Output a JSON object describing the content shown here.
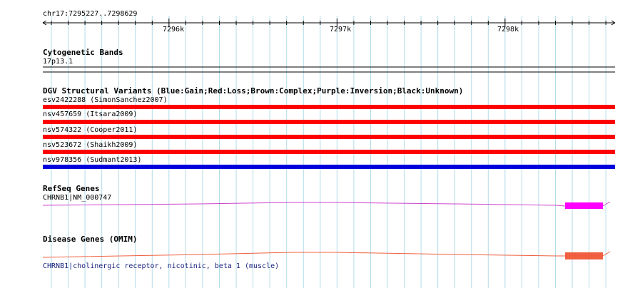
{
  "ruler": {
    "range_label": "chr17:7295227..7298629",
    "ticks": [
      "7296k",
      "7297k",
      "7298k"
    ]
  },
  "tracks": {
    "cytoband": {
      "title": "Cytogenetic Bands",
      "band": "17p13.1"
    },
    "dgv": {
      "title": "DGV Structural Variants (Blue:Gain;Red:Loss;Brown:Complex;Purple:Inversion;Black:Unknown)",
      "variants": [
        {
          "label": "esv2422288 (SimonSanchez2007)",
          "type": "Loss",
          "color": "#ff0000"
        },
        {
          "label": "nsv457659 (Itsara2009)",
          "type": "Loss",
          "color": "#ff0000"
        },
        {
          "label": "nsv574322 (Cooper2011)",
          "type": "Loss",
          "color": "#ff0000"
        },
        {
          "label": "nsv523672 (Shaikh2009)",
          "type": "Loss",
          "color": "#ff0000"
        },
        {
          "label": "nsv978356 (Sudmant2013)",
          "type": "Gain",
          "color": "#0000dd"
        }
      ]
    },
    "refseq": {
      "title": "RefSeq Genes",
      "gene_label": "CHRNB1|NM_000747",
      "color": "#ff00ff",
      "intron_color": "#cc44cc"
    },
    "disease": {
      "title": "Disease Genes (OMIM)",
      "gene_label": "CHRNB1|cholinergic receptor, nicotinic, beta 1 (muscle)",
      "color": "#f06040"
    }
  },
  "colors": {
    "grid": "#b0dce8",
    "ruler": "#000000"
  }
}
